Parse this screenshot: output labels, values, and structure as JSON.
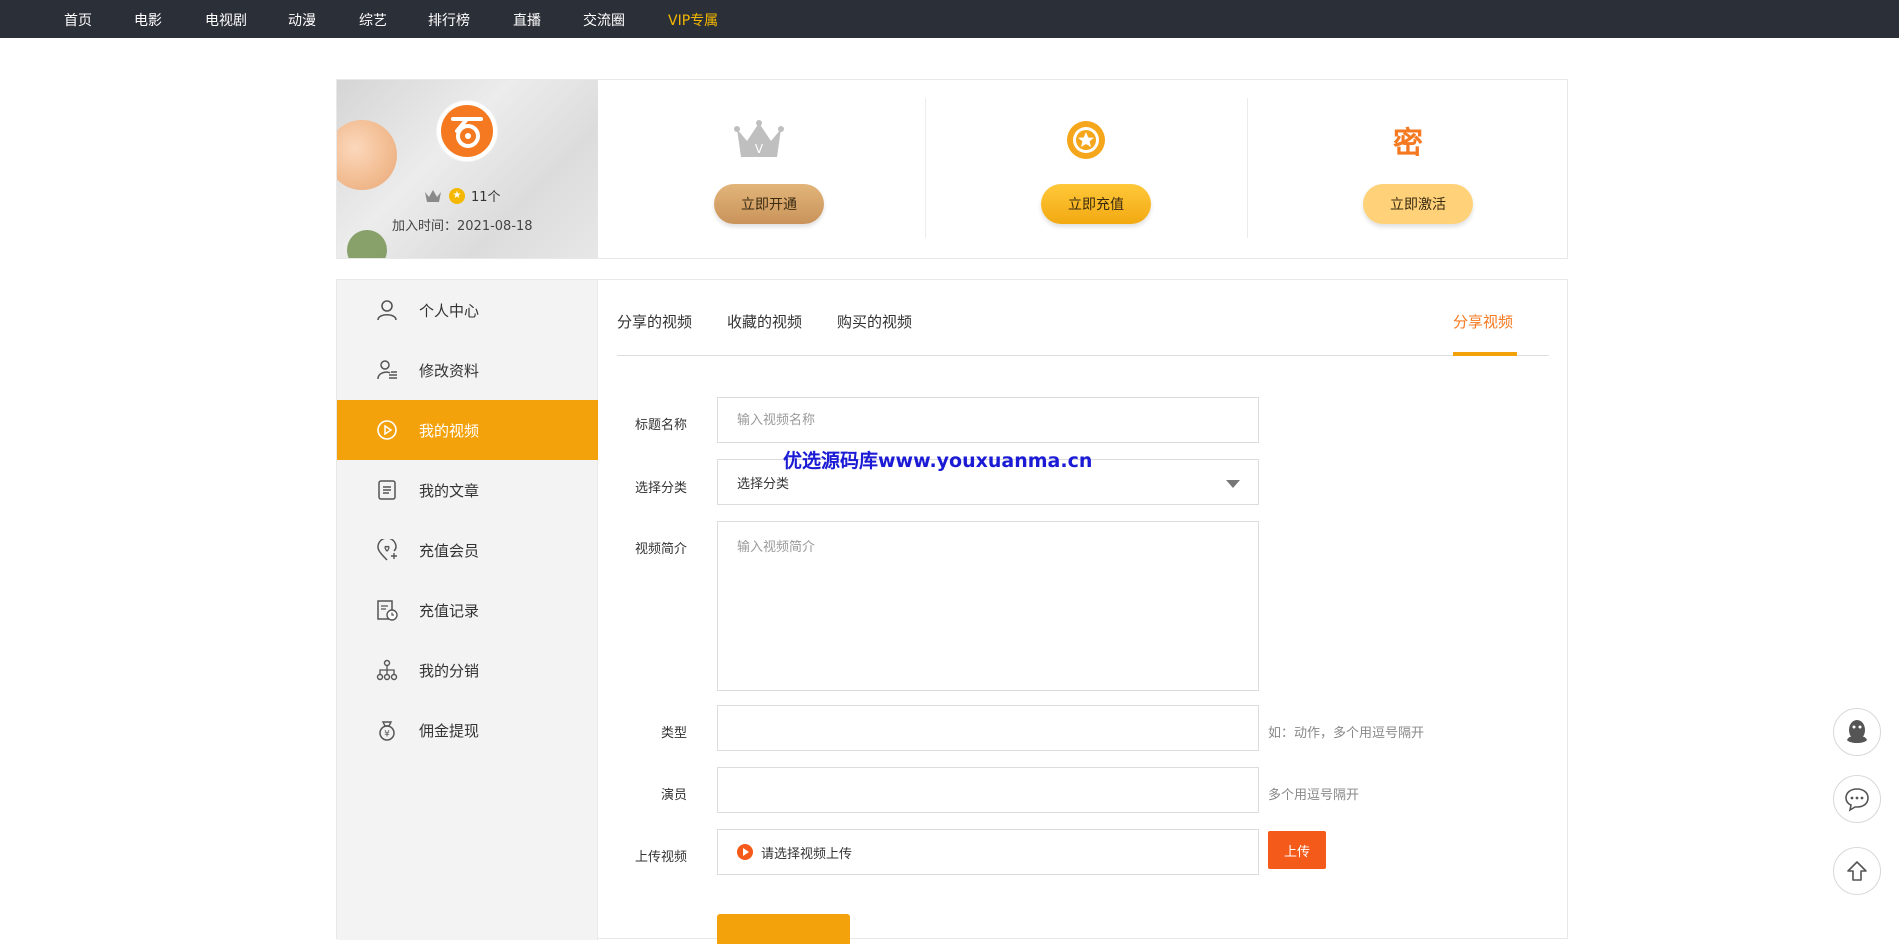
{
  "topnav": {
    "items": [
      "首页",
      "电影",
      "电视剧",
      "动漫",
      "综艺",
      "排行榜",
      "直播",
      "交流圈"
    ],
    "vip": "VIP专属"
  },
  "profile": {
    "coin_count": "11个",
    "joined_label": "加入时间：2021-08-18",
    "actions": {
      "open": {
        "label": "立即开通",
        "icon": "crown-icon",
        "color": "#d6a56b"
      },
      "recharge": {
        "label": "立即充值",
        "icon": "star-coin-icon",
        "color": "#f5b21c"
      },
      "activate": {
        "label": "立即激活",
        "glyph": "密",
        "color": "#ffd27a"
      }
    }
  },
  "sidebar": {
    "items": [
      {
        "label": "个人中心",
        "icon": "user-icon"
      },
      {
        "label": "修改资料",
        "icon": "edit-profile-icon"
      },
      {
        "label": "我的视频",
        "icon": "play-circle-icon"
      },
      {
        "label": "我的文章",
        "icon": "document-icon"
      },
      {
        "label": "充值会员",
        "icon": "heart-location-icon"
      },
      {
        "label": "充值记录",
        "icon": "record-icon"
      },
      {
        "label": "我的分销",
        "icon": "network-icon"
      },
      {
        "label": "佣金提现",
        "icon": "money-bag-icon"
      }
    ],
    "active_index": 2,
    "active_color": "#f4a20b"
  },
  "tabs": {
    "shared": "分享的视频",
    "favorites": "收藏的视频",
    "purchased": "购买的视频",
    "share_video": "分享视频"
  },
  "form": {
    "title_label": "标题名称",
    "title_placeholder": "输入视频名称",
    "category_label": "选择分类",
    "category_value": "选择分类",
    "intro_label": "视频简介",
    "intro_placeholder": "输入视频简介",
    "type_label": "类型",
    "type_hint": "如：动作，多个用逗号隔开",
    "actors_label": "演员",
    "actors_hint": "多个用逗号隔开",
    "upload_label": "上传视频",
    "upload_text": "请选择视频上传",
    "upload_button": "上传"
  },
  "watermark": "优选源码库www.youxuanma.cn",
  "colors": {
    "nav_bg": "#2b2f38",
    "accent": "#f4a20b",
    "vip": "#f5b800",
    "upload": "#f45a1a"
  }
}
